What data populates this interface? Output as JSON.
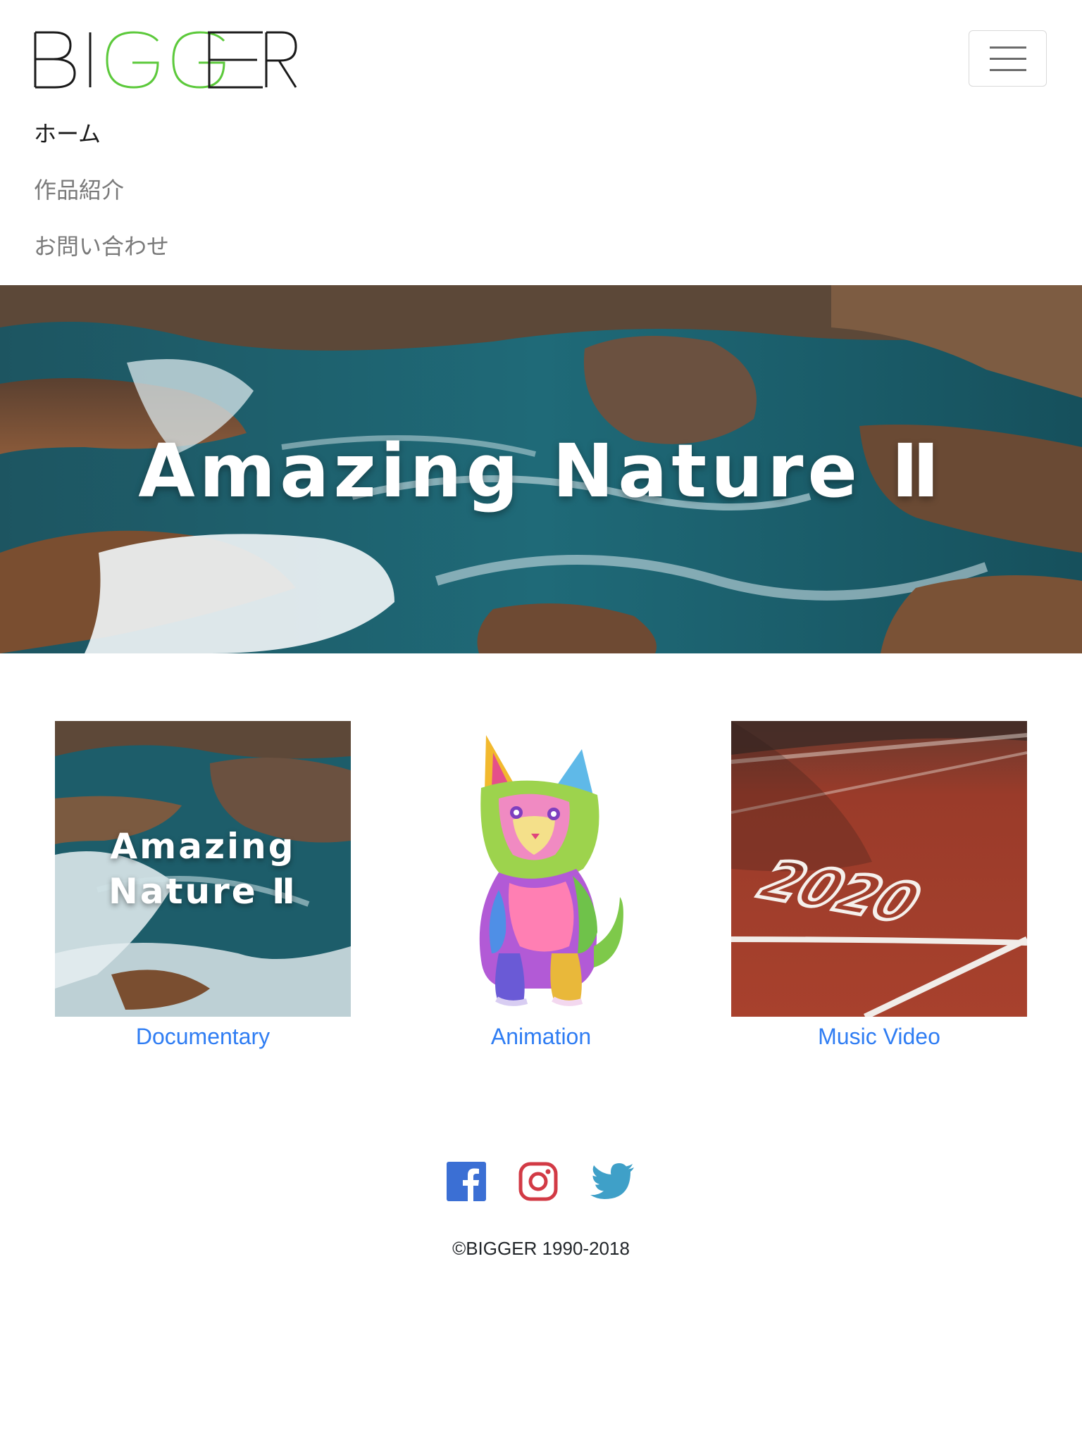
{
  "brand": {
    "text": "BIGGER",
    "colors": {
      "dark": "#1a1a1a",
      "green": "#5cc93b"
    }
  },
  "nav": {
    "toggle_icon": "hamburger-menu-icon",
    "items": [
      {
        "label": "ホーム",
        "active": true
      },
      {
        "label": "作品紹介",
        "active": false
      },
      {
        "label": "お問い合わせ",
        "active": false
      }
    ]
  },
  "hero": {
    "title": "Amazing Nature Ⅱ"
  },
  "works": [
    {
      "label": "Documentary",
      "thumb_title": [
        "Amazing",
        "Nature Ⅱ"
      ]
    },
    {
      "label": "Animation",
      "thumb_icon": "colorful-cat-illustration"
    },
    {
      "label": "Music Video",
      "thumb_text": "2020"
    }
  ],
  "social": {
    "icons": [
      "facebook-icon",
      "instagram-icon",
      "twitter-icon"
    ],
    "colors": {
      "facebook": "#3b6fd4",
      "instagram": "#d23a45",
      "twitter": "#3fa0c8"
    }
  },
  "footer": {
    "copyright": "©BIGGER 1990-2018"
  },
  "accent_color": "#2f7df3"
}
